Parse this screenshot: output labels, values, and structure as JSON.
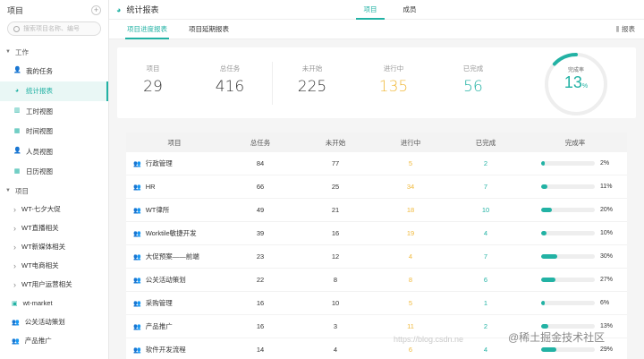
{
  "sidebar": {
    "title": "项目",
    "search_placeholder": "搜索项目名称、编号",
    "group_work": "工作",
    "work_items": [
      {
        "label": "我的任务",
        "icon": "person-icon"
      },
      {
        "label": "统计报表",
        "icon": "pie-chart-icon",
        "active": true
      },
      {
        "label": "工时视图",
        "icon": "bar-chart-icon"
      },
      {
        "label": "时间视图",
        "icon": "calendar-icon"
      },
      {
        "label": "人员视图",
        "icon": "person-icon"
      },
      {
        "label": "日历视图",
        "icon": "calendar-icon"
      }
    ],
    "group_project": "项目",
    "project_items": [
      "WT-七夕大促",
      "WT直播相关",
      "WT新媒体相关",
      "WT电商相关",
      "WT用户运营相关"
    ],
    "bottom_items": [
      {
        "label": "wt-market",
        "icon": "box-icon"
      },
      {
        "label": "公关活动策划",
        "icon": "team-icon"
      },
      {
        "label": "产品推广",
        "icon": "team-icon"
      }
    ]
  },
  "header": {
    "title": "统计报表",
    "tabs": [
      "项目",
      "成员"
    ],
    "active_tab": 0
  },
  "subnav": {
    "tabs": [
      "项目进度报表",
      "项目延期报表"
    ],
    "report_label": "报表"
  },
  "stats": {
    "items": [
      {
        "label": "项目",
        "value": "29",
        "color": "default"
      },
      {
        "label": "总任务",
        "value": "416",
        "color": "default"
      },
      {
        "label": "未开始",
        "value": "225",
        "color": "default"
      },
      {
        "label": "进行中",
        "value": "135",
        "color": "orange"
      },
      {
        "label": "已完成",
        "value": "56",
        "color": "teal"
      }
    ],
    "completion_label": "完成率",
    "completion_value": "13",
    "completion_unit": "%",
    "completion_fraction": 0.13
  },
  "table": {
    "headers": [
      "项目",
      "总任务",
      "未开始",
      "进行中",
      "已完成",
      "完成率"
    ],
    "rows": [
      {
        "name": "行政管理",
        "total": "84",
        "todo": "77",
        "doing": "5",
        "done": "2",
        "rate": "2%",
        "fill": 0.02
      },
      {
        "name": "HR",
        "total": "66",
        "todo": "25",
        "doing": "34",
        "done": "7",
        "rate": "11%",
        "fill": 0.11
      },
      {
        "name": "WT律所",
        "total": "49",
        "todo": "21",
        "doing": "18",
        "done": "10",
        "rate": "20%",
        "fill": 0.2
      },
      {
        "name": "Worktile敏捷开发",
        "total": "39",
        "todo": "16",
        "doing": "19",
        "done": "4",
        "rate": "10%",
        "fill": 0.1
      },
      {
        "name": "大促预案——前端",
        "total": "23",
        "todo": "12",
        "doing": "4",
        "done": "7",
        "rate": "30%",
        "fill": 0.3
      },
      {
        "name": "公关活动策划",
        "total": "22",
        "todo": "8",
        "doing": "8",
        "done": "6",
        "rate": "27%",
        "fill": 0.27
      },
      {
        "name": "采购管理",
        "total": "16",
        "todo": "10",
        "doing": "5",
        "done": "1",
        "rate": "6%",
        "fill": 0.06
      },
      {
        "name": "产品推广",
        "total": "16",
        "todo": "3",
        "doing": "11",
        "done": "2",
        "rate": "13%",
        "fill": 0.13
      },
      {
        "name": "软件开发流程",
        "total": "14",
        "todo": "4",
        "doing": "6",
        "done": "4",
        "rate": "29%",
        "fill": 0.29
      }
    ]
  },
  "watermark": "https://blog.csdn.ne",
  "watermark2": "@稀土掘金技术社区"
}
